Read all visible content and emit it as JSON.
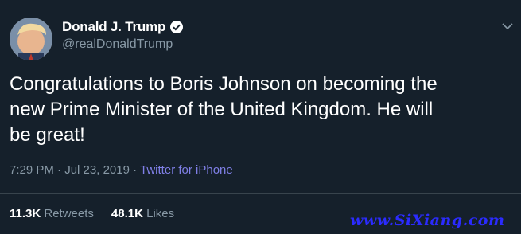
{
  "author": {
    "display_name": "Donald J. Trump",
    "handle": "@realDonaldTrump",
    "verified": true
  },
  "tweet": {
    "text": "Congratulations to Boris Johnson on becoming the\nnew Prime Minister of the United Kingdom. He will\nbe great!",
    "time": "7:29 PM",
    "separator": " · ",
    "date": "Jul 23, 2019",
    "source": "Twitter for iPhone"
  },
  "stats": {
    "retweets_count": "11.3K",
    "retweets_label": "Retweets",
    "likes_count": "48.1K",
    "likes_label": "Likes"
  },
  "watermark": "www.SiXiang.com",
  "colors": {
    "background": "#15202b",
    "text_primary": "#ffffff",
    "text_secondary": "#8899a6",
    "source_link": "#7f7fe6",
    "divider": "#38444d",
    "watermark": "#2b2bff"
  }
}
